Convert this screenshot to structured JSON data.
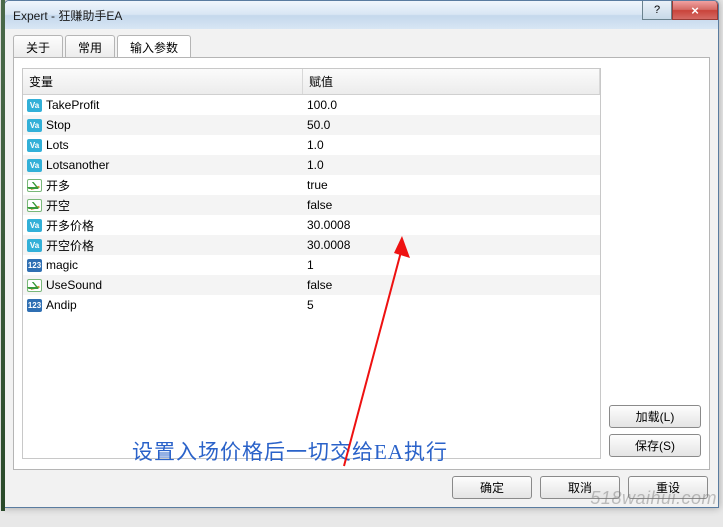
{
  "window": {
    "title": "Expert - 狂赚助手EA"
  },
  "tabs": [
    "关于",
    "常用",
    "输入参数"
  ],
  "active_tab": 2,
  "columns": {
    "name": "变量",
    "value": "赋值"
  },
  "params": [
    {
      "icon": "double",
      "name": "TakeProfit",
      "value": "100.0"
    },
    {
      "icon": "double",
      "name": "Stop",
      "value": "50.0"
    },
    {
      "icon": "double",
      "name": "Lots",
      "value": "1.0"
    },
    {
      "icon": "double",
      "name": "Lotsanother",
      "value": "1.0"
    },
    {
      "icon": "bool",
      "name": "开多",
      "value": "true"
    },
    {
      "icon": "bool",
      "name": "开空",
      "value": "false"
    },
    {
      "icon": "double",
      "name": "开多价格",
      "value": "30.0008"
    },
    {
      "icon": "double",
      "name": "开空价格",
      "value": "30.0008"
    },
    {
      "icon": "int",
      "name": "magic",
      "value": "1"
    },
    {
      "icon": "bool",
      "name": "UseSound",
      "value": "false"
    },
    {
      "icon": "int",
      "name": "Andip",
      "value": "5"
    }
  ],
  "side_buttons": {
    "load": "加载(L)",
    "save": "保存(S)"
  },
  "footer_buttons": {
    "ok": "确定",
    "cancel": "取消",
    "reset": "重设"
  },
  "annotation": "设置入场价格后一切交给EA执行",
  "watermark": "518waihui.com",
  "icon_glyph": {
    "double": "Va",
    "int": "123",
    "bool": ""
  }
}
